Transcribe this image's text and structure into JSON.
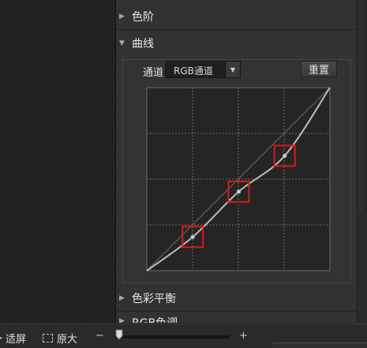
{
  "panel": {
    "sections": {
      "levels": "色阶",
      "curves": "曲线",
      "color_balance": "色彩平衡",
      "rgb_adjust": "RGB色调"
    },
    "curves": {
      "channel_label": "通道",
      "channel_value": "RGB通道",
      "reset_label": "重置"
    }
  },
  "bottom_bar": {
    "fit_label": "适屏",
    "actual_size_label": "原大",
    "minus": "−",
    "plus": "+"
  },
  "chart_data": {
    "type": "line",
    "xlim": [
      0,
      255
    ],
    "ylim": [
      0,
      255
    ],
    "grid": true,
    "grid_divisions": 4,
    "series": [
      {
        "x": [
          0,
          64,
          128,
          192,
          255
        ],
        "y": [
          0,
          47,
          110,
          160,
          255
        ]
      }
    ],
    "highlighted_points": [
      {
        "x": 64,
        "y": 47
      },
      {
        "x": 128,
        "y": 110
      },
      {
        "x": 192,
        "y": 160
      }
    ],
    "highlight_color": "#e01818"
  }
}
